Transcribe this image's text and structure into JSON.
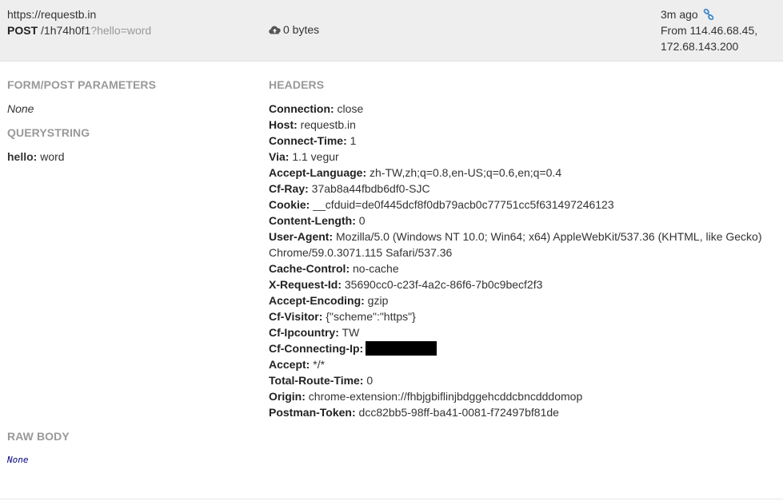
{
  "header": {
    "host": "https://requestb.in",
    "method": "POST",
    "path": "/1h74h0f1",
    "querystring": "?hello=word",
    "size": "0 bytes",
    "time_ago": "3m ago",
    "from_label": "From 114.46.68.45,",
    "from_ip2": "172.68.143.200",
    "icons": {
      "size": "cloud-upload-icon",
      "permalink": "link-icon"
    }
  },
  "form": {
    "title": "FORM/POST PARAMETERS",
    "value": "None"
  },
  "querystring": {
    "title": "QUERYSTRING",
    "items": [
      {
        "key": "hello:",
        "value": "word"
      }
    ]
  },
  "headers": {
    "title": "HEADERS",
    "items": [
      {
        "key": "Connection:",
        "value": "close"
      },
      {
        "key": "Host:",
        "value": "requestb.in"
      },
      {
        "key": "Connect-Time:",
        "value": "1"
      },
      {
        "key": "Via:",
        "value": "1.1 vegur"
      },
      {
        "key": "Accept-Language:",
        "value": "zh-TW,zh;q=0.8,en-US;q=0.6,en;q=0.4"
      },
      {
        "key": "Cf-Ray:",
        "value": "37ab8a44fbdb6df0-SJC"
      },
      {
        "key": "Cookie:",
        "value": "__cfduid=de0f445dcf8f0db79acb0c77751cc5f631497246123"
      },
      {
        "key": "Content-Length:",
        "value": "0"
      },
      {
        "key": "User-Agent:",
        "value": "Mozilla/5.0 (Windows NT 10.0; Win64; x64) AppleWebKit/537.36 (KHTML, like Gecko) Chrome/59.0.3071.115 Safari/537.36"
      },
      {
        "key": "Cache-Control:",
        "value": "no-cache"
      },
      {
        "key": "X-Request-Id:",
        "value": "35690cc0-c23f-4a2c-86f6-7b0c9becf2f3"
      },
      {
        "key": "Accept-Encoding:",
        "value": "gzip"
      },
      {
        "key": "Cf-Visitor:",
        "value": "{\"scheme\":\"https\"}"
      },
      {
        "key": "Cf-Ipcountry:",
        "value": "TW"
      },
      {
        "key": "Cf-Connecting-Ip:",
        "value": ""
      },
      {
        "key": "Accept:",
        "value": "*/*"
      },
      {
        "key": "Total-Route-Time:",
        "value": "0"
      },
      {
        "key": "Origin:",
        "value": "chrome-extension://fhbjgbiflinjbdggehcddcbncdddomop"
      },
      {
        "key": "Postman-Token:",
        "value": "dcc82bb5-98ff-ba41-0081-f72497bf81de"
      }
    ]
  },
  "raw_body": {
    "title": "RAW BODY",
    "value": "None"
  },
  "colors": {
    "topbar_bg": "#eeeeee",
    "section_title": "#999999",
    "link_icon": "#428bca",
    "raw_none": "#000080"
  }
}
